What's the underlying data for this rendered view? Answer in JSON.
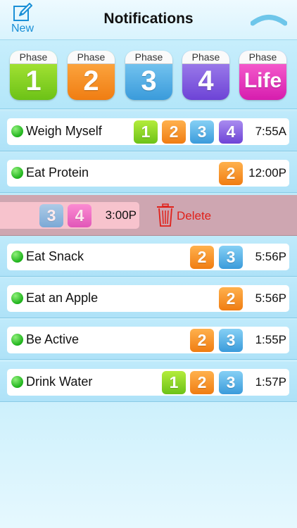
{
  "header": {
    "new_label": "New",
    "title": "Notifications"
  },
  "phases": [
    {
      "caption": "Phase",
      "label": "1",
      "color": "#6cc217"
    },
    {
      "caption": "Phase",
      "label": "2",
      "color": "#f07d12"
    },
    {
      "caption": "Phase",
      "label": "3",
      "color": "#3a9bdb"
    },
    {
      "caption": "Phase",
      "label": "4",
      "color": "#6d43d6"
    },
    {
      "caption": "Phase",
      "label": "Life",
      "color": "#d61dae"
    }
  ],
  "notifications": [
    {
      "title": "Weigh Myself",
      "phases": [
        "1",
        "2",
        "3",
        "4"
      ],
      "time": "7:55A"
    },
    {
      "title": "Eat Protein",
      "phases": [
        "2"
      ],
      "time": "12:00P"
    },
    {
      "title": "",
      "phases": [
        "3",
        "4"
      ],
      "time": "3:00P",
      "swiped": true,
      "action": "Delete"
    },
    {
      "title": "Eat Snack",
      "phases": [
        "2",
        "3"
      ],
      "time": "5:56P"
    },
    {
      "title": "Eat an Apple",
      "phases": [
        "2"
      ],
      "time": "5:56P"
    },
    {
      "title": "Be Active",
      "phases": [
        "2",
        "3"
      ],
      "time": "1:55P"
    },
    {
      "title": "Drink Water",
      "phases": [
        "1",
        "2",
        "3"
      ],
      "time": "1:57P"
    }
  ]
}
